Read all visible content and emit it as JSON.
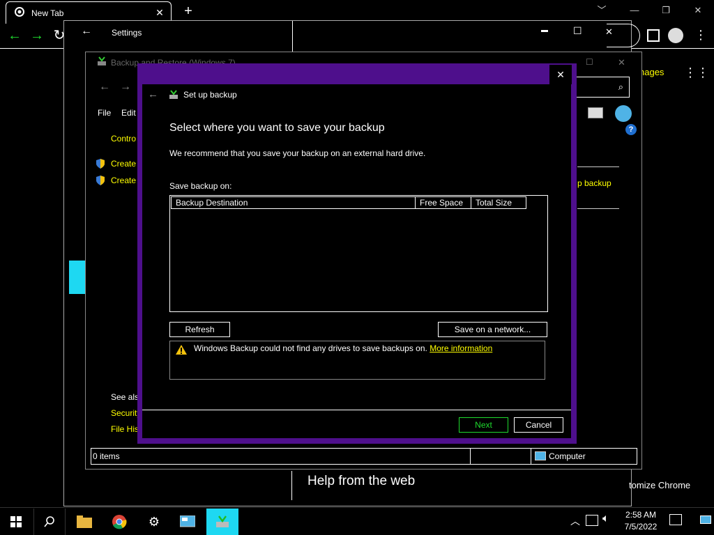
{
  "chrome": {
    "tab_title": "New Tab",
    "tab_close": "✕",
    "new_tab": "+",
    "minimize": "﹀",
    "images_link": "nages",
    "customize_label": "tomize Chrome",
    "help_web": "Help from the web"
  },
  "settings": {
    "title": "Settings",
    "back": "←",
    "minimize": "▬",
    "maximize": "☐",
    "close": "✕"
  },
  "backup_restore": {
    "title": "Backup and Restore (Windows 7)",
    "menu": [
      "File",
      "Edit"
    ],
    "control_link": "Contro",
    "create_1": "Create",
    "create_2": "Create",
    "see_also": "See also",
    "security": "Security",
    "file_history": "File His",
    "setup_backup_link": "p backup",
    "status_items": "0 items",
    "status_computer": "Computer"
  },
  "dialog": {
    "title": "Set up backup",
    "heading": "Select where you want to save your backup",
    "subheading": "We recommend that you save your backup on an external hard drive.",
    "save_on_label": "Save backup on:",
    "columns": [
      "Backup Destination",
      "Free Space",
      "Total Size"
    ],
    "refresh": "Refresh",
    "save_network": "Save on a network...",
    "warning_text": "Windows Backup could not find any drives to save backups on.",
    "warning_link": "More information",
    "next": "Next",
    "cancel": "Cancel",
    "close": "✕"
  },
  "taskbar": {
    "time": "2:58 AM",
    "date": "7/5/2022"
  },
  "colors": {
    "accent_green": "#1fdc2e",
    "link_yellow": "#ffff00",
    "dialog_purple": "#4e0f8c",
    "active_cyan": "#1ed8f2"
  }
}
